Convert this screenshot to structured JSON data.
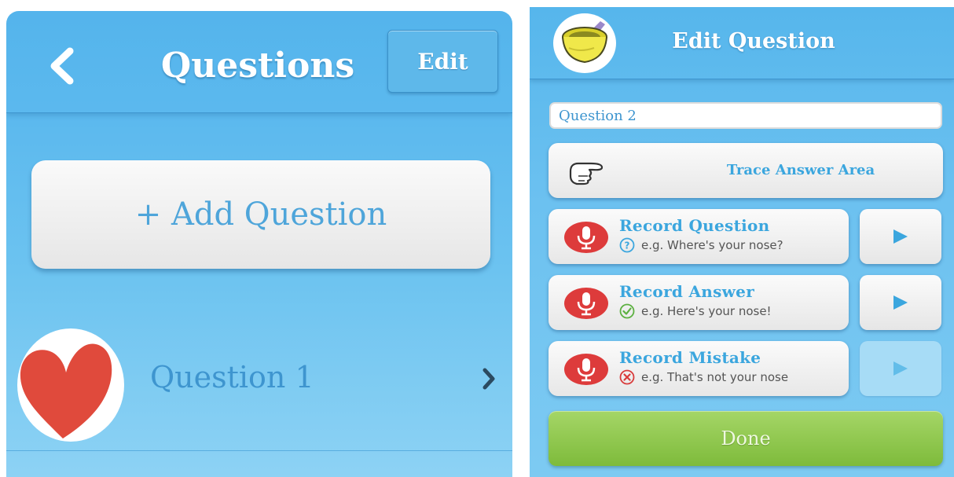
{
  "questions_screen": {
    "title": "Questions",
    "edit_label": "Edit",
    "add_question_label": "+ Add Question",
    "items": [
      {
        "label": "Question 1",
        "thumbnail_icon": "heart-icon"
      }
    ]
  },
  "edit_question_screen": {
    "title": "Edit Question",
    "question_name_value": "Question 2",
    "trace_answer_label": "Trace Answer Area",
    "recordings": [
      {
        "title": "Record Question",
        "hint": "e.g. Where's your nose?",
        "hint_icon": "question-circle-icon",
        "playable": true
      },
      {
        "title": "Record Answer",
        "hint": "e.g. Here's your nose!",
        "hint_icon": "check-circle-icon",
        "playable": true
      },
      {
        "title": "Record Mistake",
        "hint": "e.g. That's not your nose",
        "hint_icon": "x-circle-icon",
        "playable": false
      }
    ],
    "done_label": "Done"
  },
  "colors": {
    "sky_blue": "#5cb9ee",
    "label_blue": "#3ba6de",
    "mic_red": "#dd3b3b",
    "done_green": "#8fc74e",
    "heart_red": "#e04a3c"
  }
}
